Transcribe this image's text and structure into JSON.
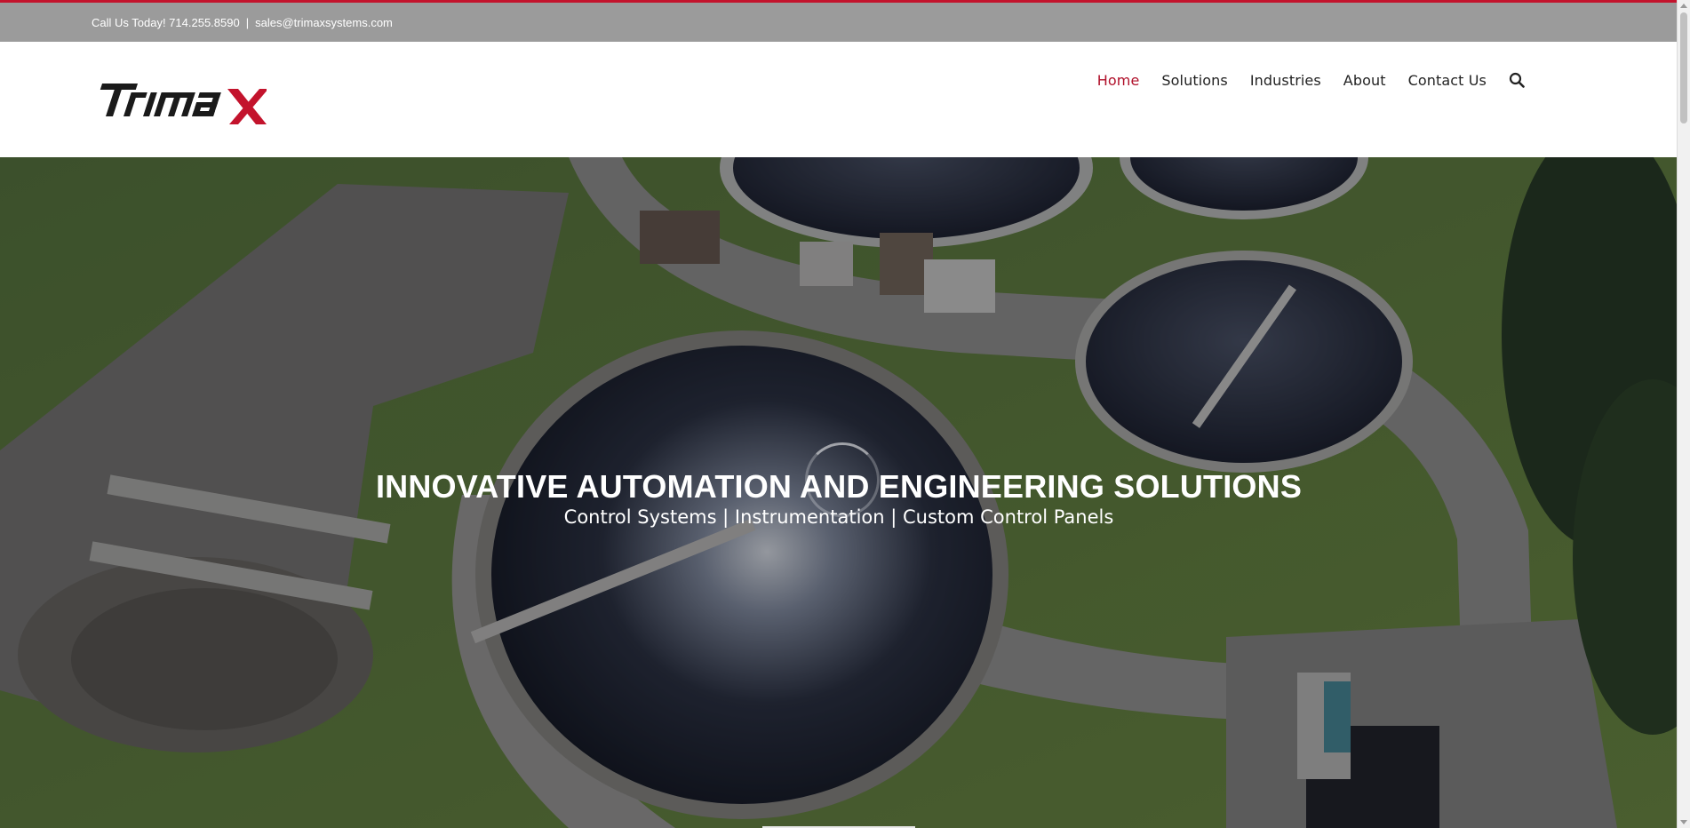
{
  "topbar": {
    "phone": "Call Us Today! 714.255.8590",
    "separator": "|",
    "email": "sales@trimaxsystems.com"
  },
  "brand": {
    "logo_text": "Trimax",
    "colors": {
      "accent": "#c3132c",
      "dark": "#1a1a1a"
    }
  },
  "nav": {
    "items": [
      {
        "label": "Home",
        "active": true
      },
      {
        "label": "Solutions"
      },
      {
        "label": "Industries"
      },
      {
        "label": "About"
      },
      {
        "label": "Contact Us"
      }
    ],
    "search_icon": "search-icon"
  },
  "hero": {
    "title": "INNOVATIVE AUTOMATION AND ENGINEERING SOLUTIONS",
    "subtitle": "Control Systems | Instrumentation | Custom Control Panels"
  }
}
